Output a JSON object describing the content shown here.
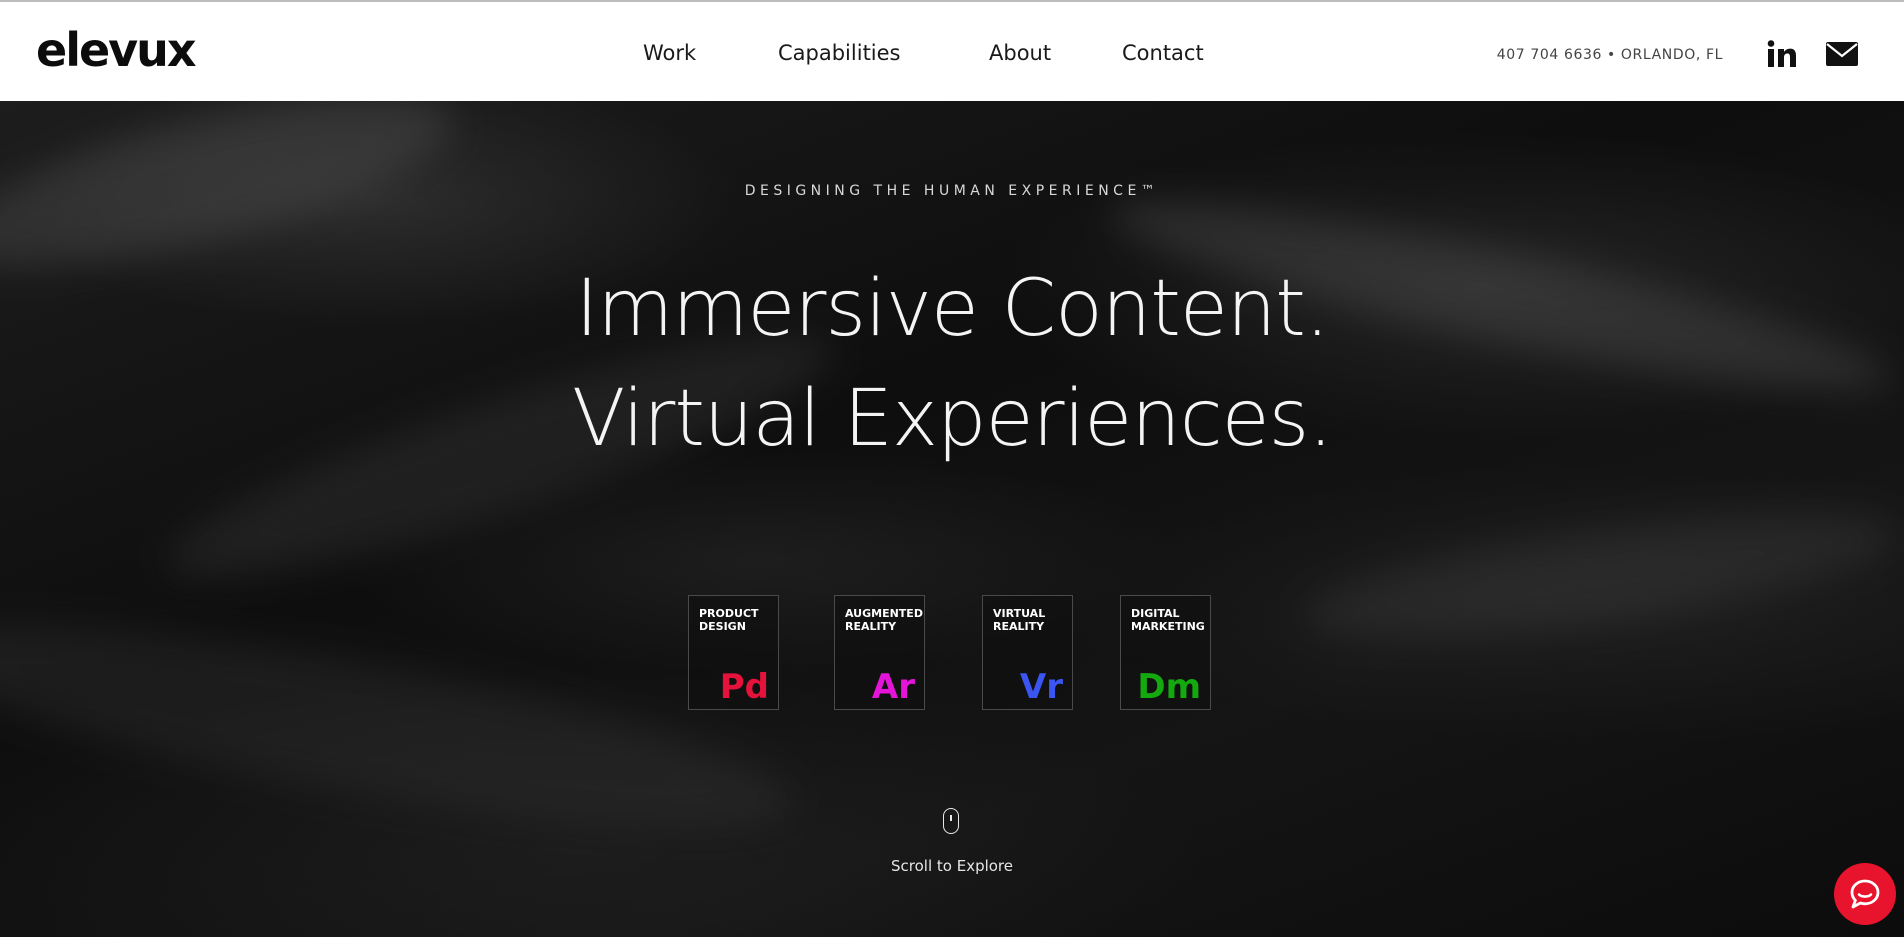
{
  "header": {
    "logo": "elevux",
    "nav": [
      {
        "label": "Work"
      },
      {
        "label": "Capabilities"
      },
      {
        "label": "About"
      },
      {
        "label": "Contact"
      }
    ],
    "contact_info": "407 704 6636 • ORLANDO, FL",
    "social": [
      {
        "icon": "linkedin-icon"
      },
      {
        "icon": "envelope-icon"
      }
    ]
  },
  "hero": {
    "tagline": "DESIGNING THE HUMAN EXPERIENCE™",
    "headline_line1": "Immersive Content.",
    "headline_line2": "Virtual Experiences.",
    "tiles": [
      {
        "label": "Product Design",
        "abbr": "Pd",
        "color": "#e5123b"
      },
      {
        "label": "Augmented Reality",
        "abbr": "Ar",
        "color": "#e514d9"
      },
      {
        "label": "Virtual Reality",
        "abbr": "Vr",
        "color": "#3b55f0"
      },
      {
        "label": "Digital Marketing",
        "abbr": "Dm",
        "color": "#14a90f"
      }
    ],
    "scroll_label": "Scroll to Explore"
  },
  "chat": {
    "icon": "chat-bubble-icon",
    "color": "#e8132c"
  }
}
